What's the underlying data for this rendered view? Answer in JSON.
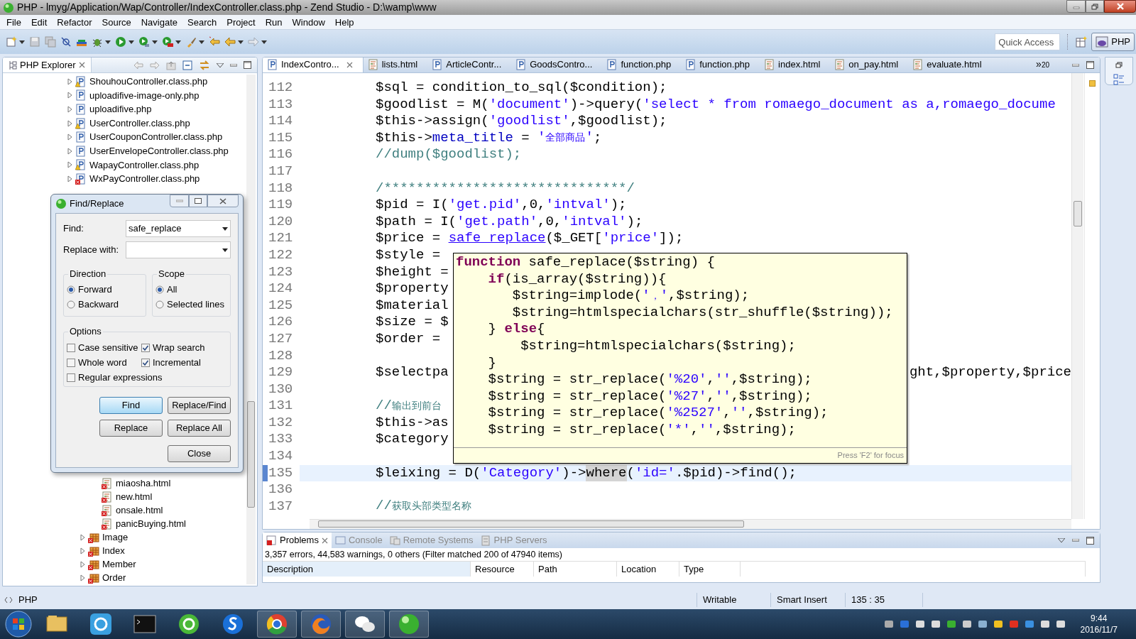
{
  "window": {
    "title": "PHP - lmyg/Application/Wap/Controller/IndexController.class.php - Zend Studio - D:\\wamp\\www"
  },
  "menu": [
    "File",
    "Edit",
    "Refactor",
    "Source",
    "Navigate",
    "Search",
    "Project",
    "Run",
    "Window",
    "Help"
  ],
  "toolbar": {
    "quick_access": {
      "placeholder": "Quick Access"
    },
    "perspective": "PHP"
  },
  "explorer": {
    "title": "PHP Explorer",
    "files": [
      {
        "label": "ShouhouController.class.php",
        "kind": "php-warning"
      },
      {
        "label": "uploadifive-image-only.php",
        "kind": "php"
      },
      {
        "label": "uploadifive.php",
        "kind": "php"
      },
      {
        "label": "UserController.class.php",
        "kind": "php-warning"
      },
      {
        "label": "UserCouponController.class.php",
        "kind": "php"
      },
      {
        "label": "UserEnvelopeController.class.php",
        "kind": "php"
      },
      {
        "label": "WapayController.class.php",
        "kind": "php-warning"
      },
      {
        "label": "WxPayController.class.php",
        "kind": "php-error"
      }
    ],
    "views": [
      {
        "label": "miaosha.html",
        "kind": "html-error"
      },
      {
        "label": "new.html",
        "kind": "html-error"
      },
      {
        "label": "onsale.html",
        "kind": "html-error"
      },
      {
        "label": "panicBuying.html",
        "kind": "html-error"
      }
    ],
    "folders": [
      {
        "label": "Image",
        "kind": "folder-error"
      },
      {
        "label": "Index",
        "kind": "folder-error"
      },
      {
        "label": "Member",
        "kind": "folder-error"
      },
      {
        "label": "Order",
        "kind": "folder-error"
      }
    ]
  },
  "editor_tabs": [
    {
      "label": "IndexContro...",
      "kind": "php",
      "selected": true
    },
    {
      "label": "lists.html",
      "kind": "html",
      "selected": false
    },
    {
      "label": "ArticleContr...",
      "kind": "php",
      "selected": false
    },
    {
      "label": "GoodsContro...",
      "kind": "php",
      "selected": false
    },
    {
      "label": "function.php",
      "kind": "php",
      "selected": false
    },
    {
      "label": "function.php",
      "kind": "php",
      "selected": false
    },
    {
      "label": "index.html",
      "kind": "html",
      "selected": false
    },
    {
      "label": "on_pay.html",
      "kind": "html",
      "selected": false
    },
    {
      "label": "evaluate.html",
      "kind": "html",
      "selected": false
    }
  ],
  "tab_overflow": {
    "symbol": "»",
    "count": "20"
  },
  "code": [
    {
      "number": "112",
      "current": false,
      "segments": [
        {
          "kind": "plain",
          "text": "$sql = condition_to_sql($condition);"
        }
      ]
    },
    {
      "number": "113",
      "current": false,
      "segments": [
        {
          "kind": "plain",
          "text": "$goodlist = M("
        },
        {
          "kind": "string",
          "text": "'document'"
        },
        {
          "kind": "plain",
          "text": ")->query("
        },
        {
          "kind": "string",
          "text": "'select * from romaego_document as a,romaego_docume"
        }
      ]
    },
    {
      "number": "114",
      "current": false,
      "segments": [
        {
          "kind": "plain",
          "text": "$this->assign("
        },
        {
          "kind": "string",
          "text": "'goodlist'"
        },
        {
          "kind": "plain",
          "text": ",$goodlist);"
        }
      ]
    },
    {
      "number": "115",
      "current": false,
      "segments": [
        {
          "kind": "plain",
          "text": "$this->"
        },
        {
          "kind": "field",
          "text": "meta_title"
        },
        {
          "kind": "plain",
          "text": " = "
        },
        {
          "kind": "string",
          "text": "'全部商品'"
        },
        {
          "kind": "plain",
          "text": ";"
        }
      ]
    },
    {
      "number": "116",
      "current": false,
      "segments": [
        {
          "kind": "comment",
          "text": "//dump($goodlist);"
        }
      ]
    },
    {
      "number": "117"
    },
    {
      "number": "118",
      "current": false,
      "segments": [
        {
          "kind": "comment",
          "text": "/******************************/"
        }
      ]
    },
    {
      "number": "119",
      "current": false,
      "segments": [
        {
          "kind": "plain",
          "text": "$pid = I("
        },
        {
          "kind": "string",
          "text": "'get.pid'"
        },
        {
          "kind": "plain",
          "text": ",0,"
        },
        {
          "kind": "string",
          "text": "'intval'"
        },
        {
          "kind": "plain",
          "text": ");"
        }
      ]
    },
    {
      "number": "120",
      "current": false,
      "segments": [
        {
          "kind": "plain",
          "text": "$path = I("
        },
        {
          "kind": "string",
          "text": "'get.path'"
        },
        {
          "kind": "plain",
          "text": ",0,"
        },
        {
          "kind": "string",
          "text": "'intval'"
        },
        {
          "kind": "plain",
          "text": ");"
        }
      ]
    },
    {
      "number": "121",
      "current": false,
      "segments": [
        {
          "kind": "plain",
          "text": "$price = "
        },
        {
          "kind": "link",
          "text": "safe_replace"
        },
        {
          "kind": "plain",
          "text": "($_GET["
        },
        {
          "kind": "string",
          "text": "'price'"
        },
        {
          "kind": "plain",
          "text": "]);"
        }
      ]
    },
    {
      "number": "122",
      "current": false,
      "segments": [
        {
          "kind": "plain",
          "text": "$style ="
        }
      ]
    },
    {
      "number": "123",
      "current": false,
      "segments": [
        {
          "kind": "plain",
          "text": "$height ="
        }
      ]
    },
    {
      "number": "124",
      "current": false,
      "segments": [
        {
          "kind": "plain",
          "text": "$property"
        }
      ]
    },
    {
      "number": "125",
      "current": false,
      "segments": [
        {
          "kind": "plain",
          "text": "$material"
        }
      ]
    },
    {
      "number": "126",
      "current": false,
      "segments": [
        {
          "kind": "plain",
          "text": "$size = $"
        }
      ]
    },
    {
      "number": "127",
      "current": false,
      "segments": [
        {
          "kind": "plain",
          "text": "$order ="
        }
      ]
    },
    {
      "number": "128"
    },
    {
      "number": "129",
      "current": false,
      "segments": [
        {
          "kind": "plain",
          "text": "$selectpa"
        }
      ],
      "tail": "ght,$property,$price"
    },
    {
      "number": "130"
    },
    {
      "number": "131",
      "current": false,
      "segments": [
        {
          "kind": "comment",
          "text": "//输出到前台"
        }
      ]
    },
    {
      "number": "132",
      "current": false,
      "segments": [
        {
          "kind": "plain",
          "text": "$this->as"
        }
      ]
    },
    {
      "number": "133",
      "current": false,
      "segments": [
        {
          "kind": "plain",
          "text": "$category"
        }
      ]
    },
    {
      "number": "134"
    },
    {
      "number": "135",
      "current": true,
      "segments": [
        {
          "kind": "plain",
          "text": "$leixing = D("
        },
        {
          "kind": "string",
          "text": "'Category'"
        },
        {
          "kind": "plain",
          "text": ")->"
        },
        {
          "kind": "occurrence",
          "text": "where"
        },
        {
          "kind": "plain",
          "text": "("
        },
        {
          "kind": "string",
          "text": "'id='"
        },
        {
          "kind": "plain",
          "text": ".$pid)->find();"
        }
      ]
    },
    {
      "number": "136"
    },
    {
      "number": "137",
      "current": false,
      "segments": [
        {
          "kind": "comment",
          "text": "//获取头部类型名称"
        }
      ]
    }
  ],
  "hover": {
    "lines": [
      [
        {
          "kind": "keyword",
          "text": "function"
        },
        {
          "kind": "plain",
          "text": " safe_replace($string) {"
        }
      ],
      [
        {
          "kind": "keyword",
          "text": "    if"
        },
        {
          "kind": "plain",
          "text": "(is_array($string)){"
        }
      ],
      [
        {
          "kind": "plain",
          "text": "       $string=implode("
        },
        {
          "kind": "string",
          "text": "'，'"
        },
        {
          "kind": "plain",
          "text": ",$string);"
        }
      ],
      [
        {
          "kind": "plain",
          "text": "       $string=htmlspecialchars(str_shuffle($string));"
        }
      ],
      [
        {
          "kind": "plain",
          "text": "    } "
        },
        {
          "kind": "keyword",
          "text": "else"
        },
        {
          "kind": "plain",
          "text": "{"
        }
      ],
      [
        {
          "kind": "plain",
          "text": "        $string=htmlspecialchars($string);"
        }
      ],
      [
        {
          "kind": "plain",
          "text": "    }"
        }
      ],
      [
        {
          "kind": "plain",
          "text": "    $string = str_replace("
        },
        {
          "kind": "string",
          "text": "'%20'"
        },
        {
          "kind": "plain",
          "text": ","
        },
        {
          "kind": "string",
          "text": "''"
        },
        {
          "kind": "plain",
          "text": ",$string);"
        }
      ],
      [
        {
          "kind": "plain",
          "text": "    $string = str_replace("
        },
        {
          "kind": "string",
          "text": "'%27'"
        },
        {
          "kind": "plain",
          "text": ","
        },
        {
          "kind": "string",
          "text": "''"
        },
        {
          "kind": "plain",
          "text": ",$string);"
        }
      ],
      [
        {
          "kind": "plain",
          "text": "    $string = str_replace("
        },
        {
          "kind": "string",
          "text": "'%2527'"
        },
        {
          "kind": "plain",
          "text": ","
        },
        {
          "kind": "string",
          "text": "''"
        },
        {
          "kind": "plain",
          "text": ",$string);"
        }
      ],
      [
        {
          "kind": "plain",
          "text": "    $string = str_replace("
        },
        {
          "kind": "string",
          "text": "'*'"
        },
        {
          "kind": "plain",
          "text": ","
        },
        {
          "kind": "string",
          "text": "''"
        },
        {
          "kind": "plain",
          "text": ",$string);"
        }
      ]
    ],
    "footer": "Press 'F2' for focus"
  },
  "find_dialog": {
    "title": "Find/Replace",
    "find_label": "Find:",
    "find_value": "safe_replace",
    "replace_label": "Replace with:",
    "direction": {
      "title": "Direction",
      "options": [
        {
          "label": "Forward",
          "selected": true
        },
        {
          "label": "Backward",
          "selected": false
        }
      ]
    },
    "scope": {
      "title": "Scope",
      "options": [
        {
          "label": "All",
          "selected": true
        },
        {
          "label": "Selected lines",
          "selected": false
        }
      ]
    },
    "options": {
      "title": "Options",
      "items": [
        {
          "label": "Case sensitive",
          "checked": false
        },
        {
          "label": "Wrap search",
          "checked": true
        },
        {
          "label": "Whole word",
          "checked": false
        },
        {
          "label": "Incremental",
          "checked": true
        },
        {
          "label": "Regular expressions",
          "checked": false
        }
      ]
    },
    "buttons": [
      {
        "label": "Find",
        "default": true
      },
      {
        "label": "Replace/Find",
        "default": false
      },
      {
        "label": "Replace",
        "default": false
      },
      {
        "label": "Replace All",
        "default": false
      },
      {
        "label": "Close",
        "default": false
      }
    ]
  },
  "problems": {
    "tabs": [
      {
        "label": "Problems",
        "kind": "problems",
        "selected": true
      },
      {
        "label": "Console",
        "kind": "console",
        "selected": false
      },
      {
        "label": "Remote Systems",
        "kind": "remote",
        "selected": false
      },
      {
        "label": "PHP Servers",
        "kind": "servers",
        "selected": false
      }
    ],
    "summary": "3,357 errors, 44,583 warnings, 0 others (Filter matched 200 of 47940 items)",
    "columns": [
      {
        "label": "Description",
        "sorted": true
      },
      {
        "label": "Resource",
        "sorted": false
      },
      {
        "label": "Path",
        "sorted": false
      },
      {
        "label": "Location",
        "sorted": false
      },
      {
        "label": "Type",
        "sorted": false
      }
    ]
  },
  "status_bar": {
    "perspective": "PHP",
    "mode": "Writable",
    "insert": "Smart Insert",
    "position": "135 : 35"
  },
  "taskbar": {
    "time": "9:44",
    "date": "2016/11/7"
  }
}
